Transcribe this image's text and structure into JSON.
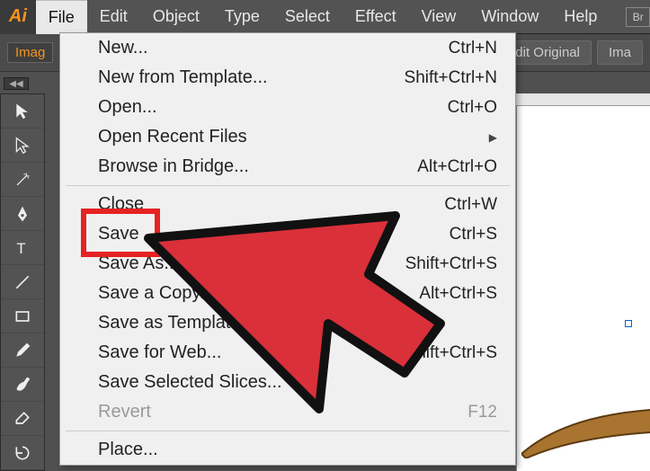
{
  "app_icon": "Ai",
  "menubar": {
    "file": "File",
    "edit": "Edit",
    "object": "Object",
    "type": "Type",
    "select": "Select",
    "effect": "Effect",
    "view": "View",
    "window": "Window",
    "help": "Help",
    "br": "Br"
  },
  "options": {
    "image_label": "Imag",
    "edit_original": "dit Original",
    "ima_btn": "Ima"
  },
  "collapse": "◀◀",
  "dropdown": {
    "new": {
      "label": "New...",
      "sc": "Ctrl+N"
    },
    "new_template": {
      "label": "New from Template...",
      "sc": "Shift+Ctrl+N"
    },
    "open": {
      "label": "Open...",
      "sc": "Ctrl+O"
    },
    "open_recent": {
      "label": "Open Recent Files",
      "sc": ""
    },
    "browse_bridge": {
      "label": "Browse in Bridge...",
      "sc": "Alt+Ctrl+O"
    },
    "close": {
      "label": "Close",
      "sc": "Ctrl+W"
    },
    "save": {
      "label": "Save",
      "sc": "Ctrl+S"
    },
    "save_as": {
      "label": "Save As...",
      "sc": "Shift+Ctrl+S"
    },
    "save_copy": {
      "label": "Save a Copy...",
      "sc": "Alt+Ctrl+S"
    },
    "save_template": {
      "label": "Save as Template...",
      "sc": ""
    },
    "save_web": {
      "label": "Save for Web...",
      "sc": "Alt+Shift+Ctrl+S"
    },
    "save_slices": {
      "label": "Save Selected Slices...",
      "sc": ""
    },
    "revert": {
      "label": "Revert",
      "sc": "F12"
    },
    "place": {
      "label": "Place...",
      "sc": ""
    }
  }
}
